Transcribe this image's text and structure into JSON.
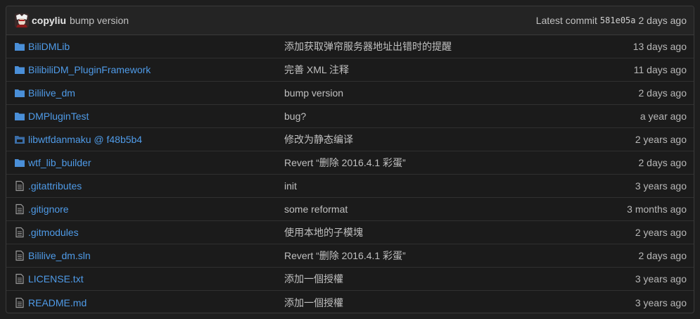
{
  "latest_commit": {
    "author": "copyliu",
    "message": "bump version",
    "label": "Latest commit",
    "sha": "581e05a",
    "age": "2 days ago"
  },
  "colors": {
    "link": "#4f9be8",
    "folder_icon": "#4a8fd8",
    "submodule_icon": "#3b6ea8",
    "file_icon": "#9a9a9a"
  },
  "files": [
    {
      "icon": "folder-icon",
      "name": "BiliDMLib",
      "message": "添加获取弹帘服务器地址出错时的提醒",
      "age": "13 days ago"
    },
    {
      "icon": "folder-icon",
      "name": "BilibiliDM_PluginFramework",
      "message": "完善 XML 注释",
      "age": "11 days ago"
    },
    {
      "icon": "folder-icon",
      "name": "Bililive_dm",
      "message": "bump version",
      "age": "2 days ago"
    },
    {
      "icon": "folder-icon",
      "name": "DMPluginTest",
      "message": "bug?",
      "age": "a year ago"
    },
    {
      "icon": "submodule-icon",
      "name": "libwtfdanmaku @ f48b5b4",
      "message": "修改为静态编译",
      "age": "2 years ago"
    },
    {
      "icon": "folder-icon",
      "name": "wtf_lib_builder",
      "message": "Revert “删除 2016.4.1 彩蛋”",
      "age": "2 days ago"
    },
    {
      "icon": "file-icon",
      "name": ".gitattributes",
      "message": "init",
      "age": "3 years ago"
    },
    {
      "icon": "file-icon",
      "name": ".gitignore",
      "message": "some reformat",
      "age": "3 months ago"
    },
    {
      "icon": "file-icon",
      "name": ".gitmodules",
      "message": "使用本地的子模塊",
      "age": "2 years ago"
    },
    {
      "icon": "file-icon",
      "name": "Bililive_dm.sln",
      "message": "Revert “删除 2016.4.1 彩蛋”",
      "age": "2 days ago"
    },
    {
      "icon": "file-icon",
      "name": "LICENSE.txt",
      "message": "添加一個授權",
      "age": "3 years ago"
    },
    {
      "icon": "file-icon",
      "name": "README.md",
      "message": "添加一個授權",
      "age": "3 years ago"
    }
  ]
}
